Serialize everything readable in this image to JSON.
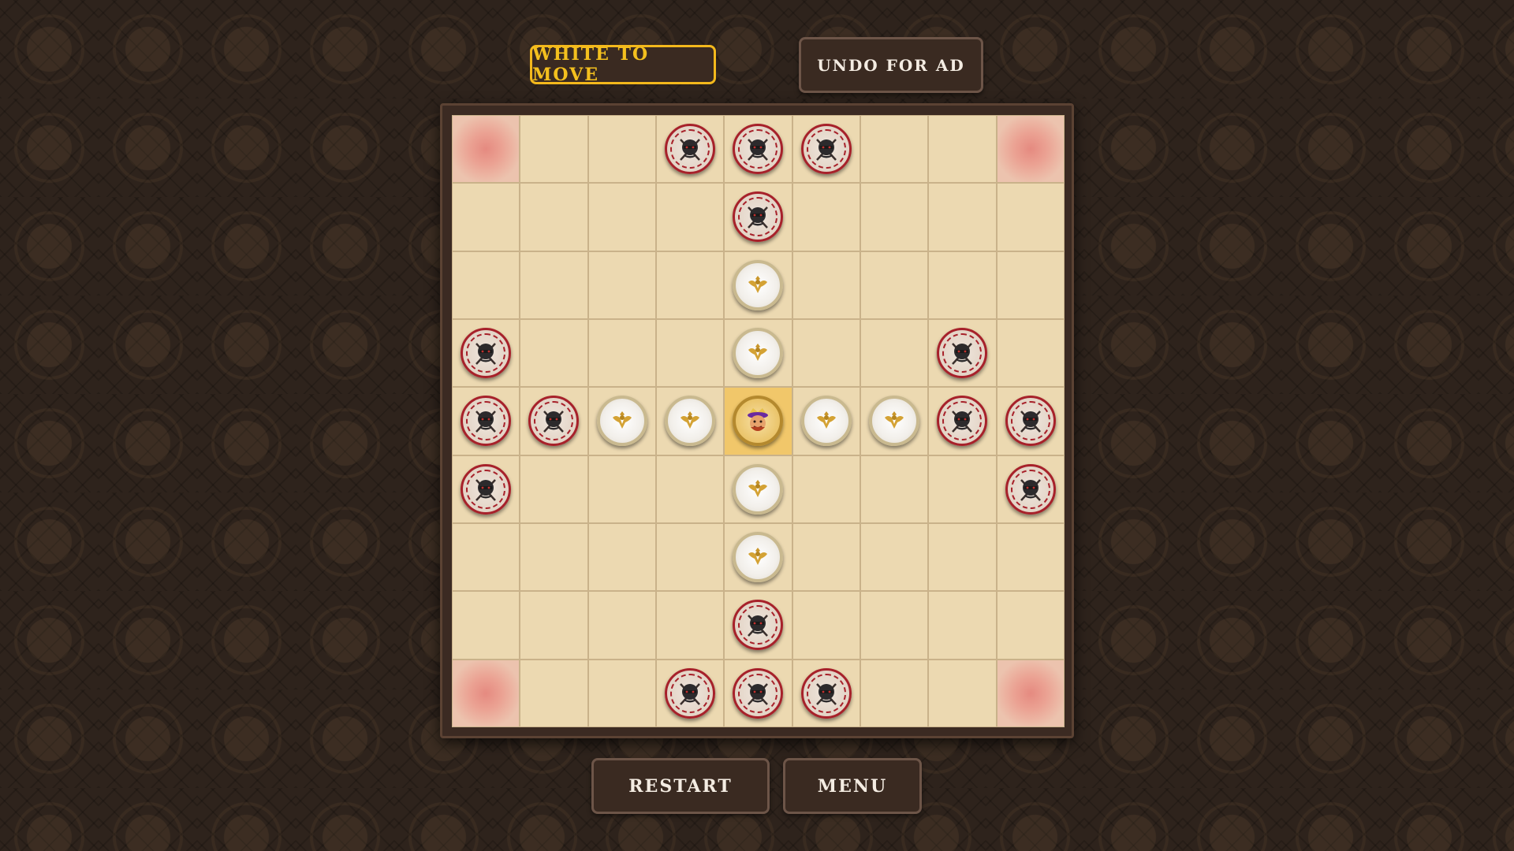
{
  "status": {
    "text": "WHITE TO MOVE"
  },
  "buttons": {
    "undo": "UNDO FOR AD",
    "restart": "RESTART",
    "menu": "MENU"
  },
  "colors": {
    "accent": "#f4c01e",
    "attacker_ring": "#a7212a",
    "board_light": "#ecd9b1",
    "corner_highlight": "#e58a80",
    "throne": "#f1c76a"
  },
  "board": {
    "size": 9,
    "corners": [
      [
        0,
        0
      ],
      [
        0,
        8
      ],
      [
        8,
        0
      ],
      [
        8,
        8
      ]
    ],
    "throne": [
      4,
      4
    ],
    "pieces": [
      {
        "type": "attacker",
        "row": 0,
        "col": 3
      },
      {
        "type": "attacker",
        "row": 0,
        "col": 4
      },
      {
        "type": "attacker",
        "row": 0,
        "col": 5
      },
      {
        "type": "attacker",
        "row": 1,
        "col": 4
      },
      {
        "type": "defender",
        "row": 2,
        "col": 4
      },
      {
        "type": "attacker",
        "row": 3,
        "col": 0
      },
      {
        "type": "defender",
        "row": 3,
        "col": 4
      },
      {
        "type": "attacker",
        "row": 3,
        "col": 7
      },
      {
        "type": "attacker",
        "row": 4,
        "col": 0
      },
      {
        "type": "attacker",
        "row": 4,
        "col": 1
      },
      {
        "type": "defender",
        "row": 4,
        "col": 2
      },
      {
        "type": "defender",
        "row": 4,
        "col": 3
      },
      {
        "type": "king",
        "row": 4,
        "col": 4
      },
      {
        "type": "defender",
        "row": 4,
        "col": 5
      },
      {
        "type": "defender",
        "row": 4,
        "col": 6
      },
      {
        "type": "attacker",
        "row": 4,
        "col": 7
      },
      {
        "type": "attacker",
        "row": 4,
        "col": 8
      },
      {
        "type": "attacker",
        "row": 5,
        "col": 0
      },
      {
        "type": "defender",
        "row": 5,
        "col": 4
      },
      {
        "type": "attacker",
        "row": 5,
        "col": 8
      },
      {
        "type": "defender",
        "row": 6,
        "col": 4
      },
      {
        "type": "attacker",
        "row": 7,
        "col": 4
      },
      {
        "type": "attacker",
        "row": 8,
        "col": 3
      },
      {
        "type": "attacker",
        "row": 8,
        "col": 4
      },
      {
        "type": "attacker",
        "row": 8,
        "col": 5
      }
    ]
  },
  "icons": {
    "attacker": "dark-warrior-icon",
    "defender": "golden-eagle-icon",
    "king": "king-icon"
  }
}
